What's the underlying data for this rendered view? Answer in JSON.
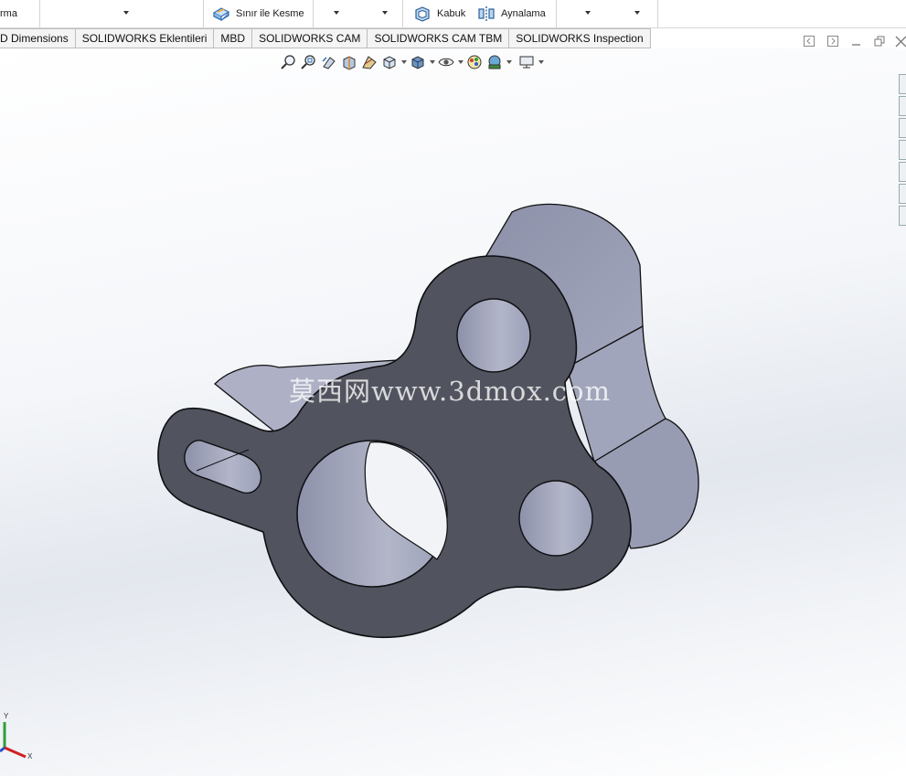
{
  "toolbar": {
    "cut_label_partial": "rma",
    "boundary_cut_label": "Sınır ile Kesme",
    "shell_label": "Kabuk",
    "mirror_label": "Aynalama"
  },
  "tabs": [
    {
      "label": "D Dimensions"
    },
    {
      "label": "SOLIDWORKS Eklentileri"
    },
    {
      "label": "MBD"
    },
    {
      "label": "SOLIDWORKS CAM"
    },
    {
      "label": "SOLIDWORKS CAM TBM"
    },
    {
      "label": "SOLIDWORKS Inspection"
    }
  ],
  "watermark": "莫西网www.3dmox.com",
  "triad": {
    "x_label": "X",
    "y_label": "Y"
  },
  "colors": {
    "part_face": "#51535e",
    "part_side": "#9397ad",
    "accent_blue": "#2a6ebb"
  }
}
